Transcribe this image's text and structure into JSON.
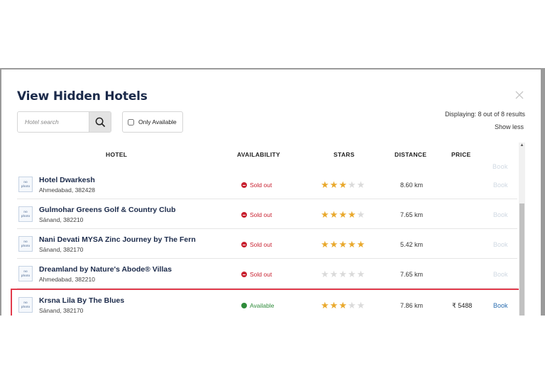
{
  "modal": {
    "title": "View Hidden Hotels",
    "close_icon": "close-icon",
    "search": {
      "placeholder": "Hotel search",
      "value": "",
      "button_icon": "search-icon"
    },
    "only_available_label": "Only Available",
    "displaying_text": "Displaying: 8 out of 8 results",
    "show_less_label": "Show less"
  },
  "table": {
    "headers": {
      "hotel": "HOTEL",
      "availability": "AVAILABILITY",
      "stars": "STARS",
      "distance": "DISTANCE",
      "price": "PRICE",
      "book": "Book"
    },
    "no_photo_label": "no photo",
    "rows": [
      {
        "name": "Hotel Dwarkesh",
        "address": "Ahmedabad, 382428",
        "availability": "Sold out",
        "stars": 3,
        "distance": "8.60 km",
        "price": "",
        "book": "Book"
      },
      {
        "name": "Gulmohar Greens Golf & Country Club",
        "address": "Sānand, 382210",
        "availability": "Sold out",
        "stars": 4,
        "distance": "7.65 km",
        "price": "",
        "book": "Book"
      },
      {
        "name": "Nani Devati MYSA Zinc Journey by The Fern",
        "address": "Sānand, 382170",
        "availability": "Sold out",
        "stars": 5,
        "distance": "5.42 km",
        "price": "",
        "book": "Book"
      },
      {
        "name": "Dreamland by Nature's Abode® Villas",
        "address": "Ahmedabad, 382210",
        "availability": "Sold out",
        "stars": 0,
        "distance": "7.65 km",
        "price": "",
        "book": "Book"
      },
      {
        "name": "Krsna Lila By The Blues",
        "address": "Sānand, 382170",
        "availability": "Available",
        "stars": 3,
        "distance": "7.86 km",
        "price": "₹ 5488",
        "book": "Book"
      }
    ]
  },
  "colors": {
    "sold_out": "#c8202f",
    "available": "#2e8b3a",
    "star_on": "#e9a82b",
    "star_off": "#dadada",
    "book_link": "#2a6db0",
    "highlight": "#e23b4c"
  }
}
